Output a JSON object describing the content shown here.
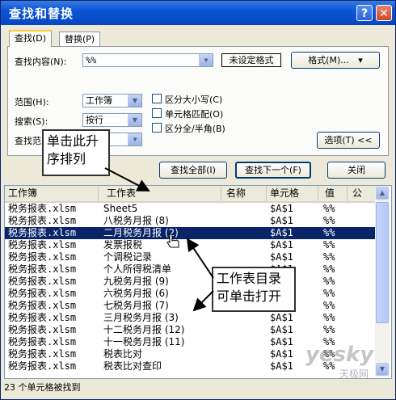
{
  "window": {
    "title": "查找和替换",
    "help_glyph": "?",
    "close_glyph": "✕",
    "accent": "#0a55d8"
  },
  "tabs": [
    {
      "label": "查找(D)",
      "active": true
    },
    {
      "label": "替换(P)",
      "active": false
    }
  ],
  "find": {
    "label": "查找内容(N):",
    "value": "%%",
    "format_status": "未设定格式",
    "format_button": "格式(M)...",
    "format_arrow": "▾"
  },
  "options": {
    "scope_label": "范围(H):",
    "scope_value": "工作簿",
    "search_label": "搜索(S):",
    "search_value": "按行",
    "lookin_label": "查找范",
    "match_case": "区分大小写(C)",
    "match_cell": "单元格匹配(O)",
    "match_width": "区分全/半角(B)",
    "options_button": "选项(T) <<"
  },
  "buttons": {
    "find_all": "查找全部(I)",
    "find_next": "查找下一个(F)",
    "close": "关闭"
  },
  "results": {
    "columns": [
      "工作簿",
      "工作表",
      "名称",
      "单元格",
      "值",
      "公"
    ],
    "rows": [
      {
        "workbook": "税务报表.xlsm",
        "sheet": "Sheet5",
        "cell": "$A$1",
        "value": "%%"
      },
      {
        "workbook": "税务报表.xlsm",
        "sheet": "八税务月报 (8)",
        "cell": "$A$1",
        "value": "%%"
      },
      {
        "workbook": "税务报表.xlsm",
        "sheet": "二月税务月报 (2)",
        "cell": "$A$1",
        "value": "%%",
        "selected": true
      },
      {
        "workbook": "税务报表.xlsm",
        "sheet": "发票报税",
        "cell": "$A$1",
        "value": "%%"
      },
      {
        "workbook": "税务报表.xlsm",
        "sheet": "个调税记录",
        "cell": "$A$1",
        "value": "%%"
      },
      {
        "workbook": "税务报表.xlsm",
        "sheet": "个人所得税清单",
        "cell": "$A$1",
        "value": "%%"
      },
      {
        "workbook": "税务报表.xlsm",
        "sheet": "九税务月报 (9)",
        "cell": "$A$1",
        "value": "%%"
      },
      {
        "workbook": "税务报表.xlsm",
        "sheet": "六税务月报 (6)",
        "cell": "$A$1",
        "value": "%%"
      },
      {
        "workbook": "税务报表.xlsm",
        "sheet": "七税务月报 (7)",
        "cell": "$A$1",
        "value": "%%"
      },
      {
        "workbook": "税务报表.xlsm",
        "sheet": "三月税务月报 (3)",
        "cell": "$A$1",
        "value": "%%"
      },
      {
        "workbook": "税务报表.xlsm",
        "sheet": "十二税务月报 (12)",
        "cell": "$A$1",
        "value": "%%"
      },
      {
        "workbook": "税务报表.xlsm",
        "sheet": "十一税务月报 (11)",
        "cell": "$A$1",
        "value": "%%"
      },
      {
        "workbook": "税务报表.xlsm",
        "sheet": "税表比对",
        "cell": "$A$1",
        "value": "%%"
      },
      {
        "workbook": "税务报表.xlsm",
        "sheet": "税表比对查印",
        "cell": "$A$1",
        "value": "%%"
      }
    ]
  },
  "status": "23 个单元格被找到",
  "callouts": {
    "sort": [
      "单击此升",
      "序排列"
    ],
    "sheets": [
      "工作表目录",
      "可单击打开"
    ]
  },
  "watermark": {
    "brand": "yesky",
    "sub": "天极网"
  }
}
